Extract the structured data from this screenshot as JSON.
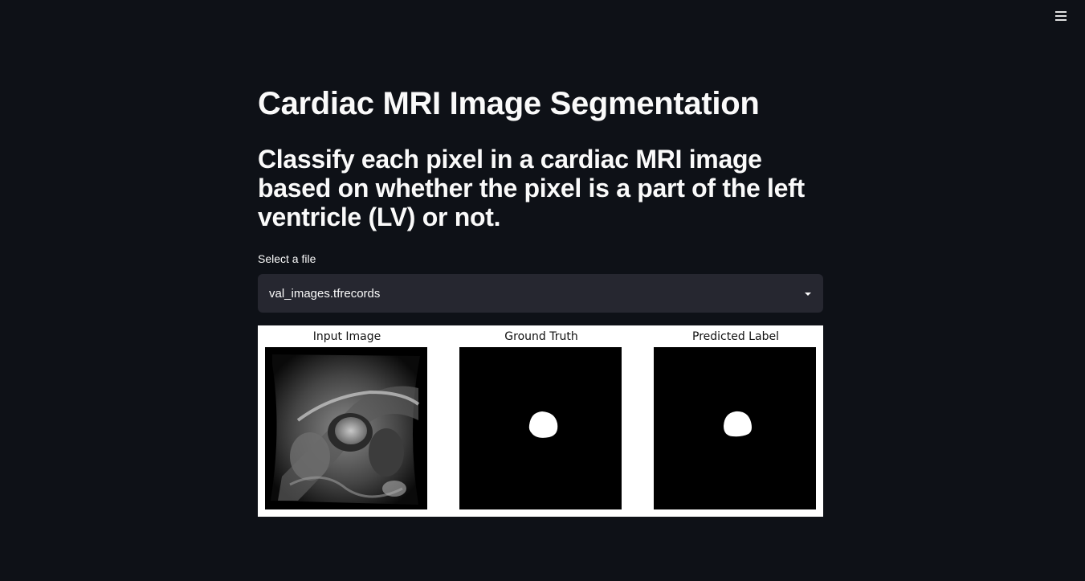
{
  "header": {
    "menu_icon": "hamburger-menu-icon"
  },
  "page": {
    "title": "Cardiac MRI Image Segmentation",
    "subtitle": "Classify each pixel in a cardiac MRI image based on whether the pixel is a part of the left ventricle (LV) or not."
  },
  "file_select": {
    "label": "Select a file",
    "value": "val_images.tfrecords",
    "icon": "caret-down-icon"
  },
  "figure": {
    "panels": [
      {
        "title": "Input Image"
      },
      {
        "title": "Ground Truth"
      },
      {
        "title": "Predicted Label"
      }
    ]
  },
  "colors": {
    "background": "#0e1117",
    "select_background": "#262730",
    "text": "#fafafa"
  }
}
